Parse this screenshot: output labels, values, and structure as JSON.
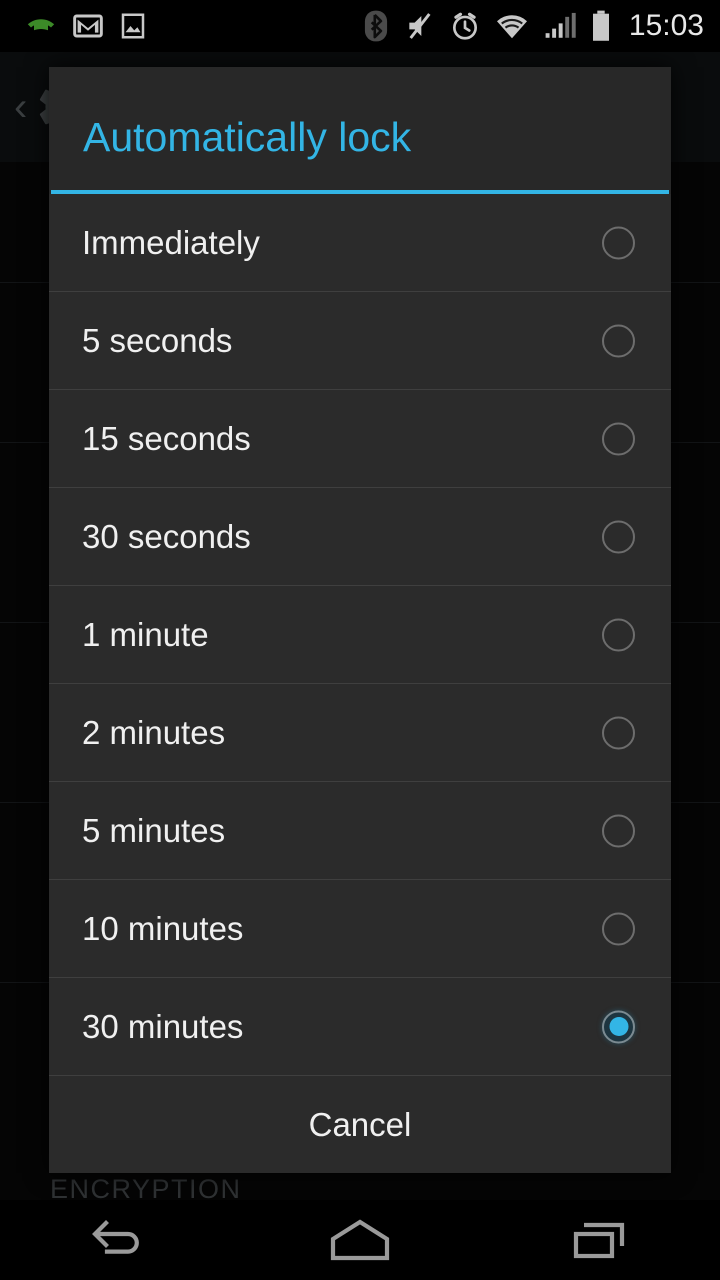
{
  "status_bar": {
    "left_icons": [
      {
        "name": "call-icon",
        "glyph": "call",
        "color": "#3c8a28"
      },
      {
        "name": "gmail-icon",
        "glyph": "gmail",
        "color": "#c8c8c8"
      },
      {
        "name": "screenshot-icon",
        "glyph": "image",
        "color": "#c8c8c8"
      }
    ],
    "right_icons": [
      {
        "name": "bluetooth-icon",
        "glyph": "bluetooth",
        "color": "#5a5a5a"
      },
      {
        "name": "mute-icon",
        "glyph": "speaker-muted",
        "color": "#c8c8c8"
      },
      {
        "name": "alarm-icon",
        "glyph": "alarm-clock",
        "color": "#c8c8c8"
      },
      {
        "name": "wifi-icon",
        "glyph": "wifi",
        "color": "#c8c8c8"
      },
      {
        "name": "signal-icon",
        "glyph": "cellular-signal",
        "color": "#c8c8c8"
      },
      {
        "name": "battery-icon",
        "glyph": "battery",
        "color": "#c8c8c8"
      }
    ],
    "clock": "15:03"
  },
  "background": {
    "section_header": "ENCRYPTION",
    "back_chevron": "‹",
    "app_icon_name": "settings-gear-icon"
  },
  "dialog": {
    "title": "Automatically lock",
    "accent_color": "#33b5e5",
    "background_color": "#2b2b2b",
    "options": [
      {
        "label": "Immediately",
        "selected": false
      },
      {
        "label": "5 seconds",
        "selected": false
      },
      {
        "label": "15 seconds",
        "selected": false
      },
      {
        "label": "30 seconds",
        "selected": false
      },
      {
        "label": "1 minute",
        "selected": false
      },
      {
        "label": "2 minutes",
        "selected": false
      },
      {
        "label": "5 minutes",
        "selected": false
      },
      {
        "label": "10 minutes",
        "selected": false
      },
      {
        "label": "30 minutes",
        "selected": true
      }
    ],
    "selected_value": "30 minutes",
    "cancel_label": "Cancel"
  },
  "nav_bar": {
    "buttons": [
      {
        "name": "nav-back-button",
        "glyph": "back-arrow"
      },
      {
        "name": "nav-home-button",
        "glyph": "home"
      },
      {
        "name": "nav-recents-button",
        "glyph": "recent-apps"
      }
    ]
  }
}
